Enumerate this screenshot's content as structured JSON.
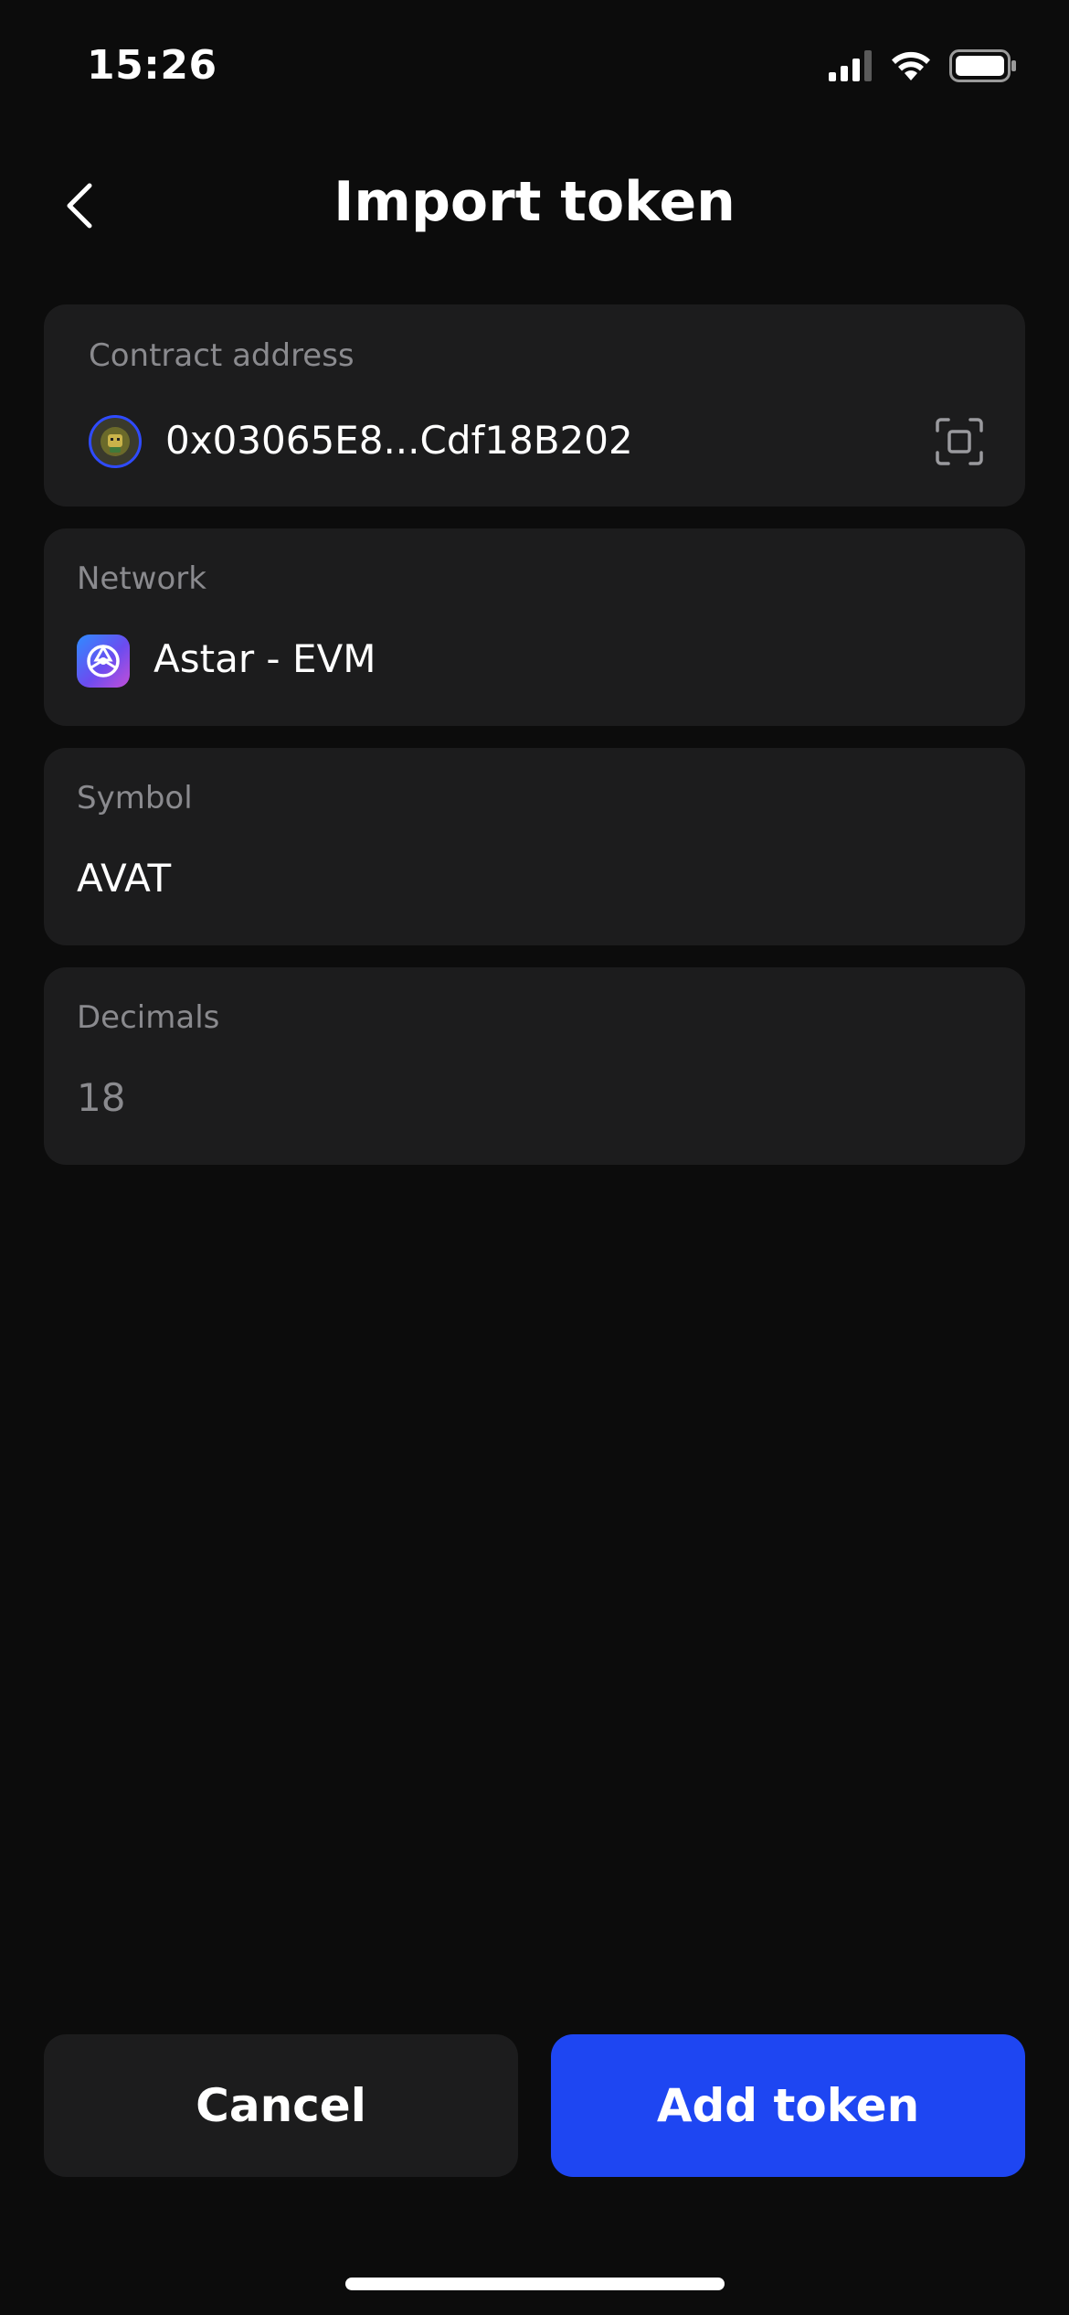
{
  "status_bar": {
    "time": "15:26",
    "icons": [
      "signal-icon",
      "wifi-icon",
      "battery-icon"
    ]
  },
  "header": {
    "title": "Import token",
    "back_icon": "chevron-left-icon"
  },
  "contract": {
    "label": "Contract address",
    "value": "0x03065E8...Cdf18B202",
    "scan_icon": "scan-icon"
  },
  "network": {
    "label": "Network",
    "value": "Astar - EVM"
  },
  "symbol": {
    "label": "Symbol",
    "value": "AVAT"
  },
  "decimals": {
    "label": "Decimals",
    "value": "18"
  },
  "actions": {
    "cancel_label": "Cancel",
    "add_label": "Add token"
  },
  "colors": {
    "background": "#0c0c0c",
    "card": "#1c1c1d",
    "accent": "#1e46f2",
    "muted_text": "#8a8a8e"
  }
}
